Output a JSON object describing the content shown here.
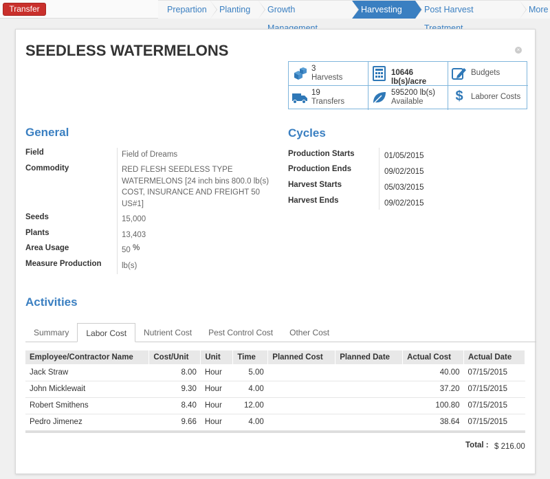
{
  "toolbar": {
    "transfer_label": "Transfer"
  },
  "breadcrumbs": [
    {
      "label": "Prepartion"
    },
    {
      "label": "Planting"
    },
    {
      "label": "Growth Management"
    },
    {
      "label": "Harvesting"
    },
    {
      "label": "Post Harvest Treatment"
    },
    {
      "label": "More"
    }
  ],
  "page": {
    "title": "SEEDLESS WATERMELONS",
    "close_glyph": "×"
  },
  "stats": {
    "harvests_count": "3",
    "harvests_label": "Harvests",
    "yield": "10646 lb(s)/acre",
    "budgets": "Budgets",
    "transfers_count": "19",
    "transfers_label": "Transfers",
    "available_qty": "595200 lb(s)",
    "available_label": "Available",
    "laborer_costs": "Laborer Costs",
    "dollar_glyph": "$"
  },
  "general": {
    "heading": "General",
    "field_label": "Field",
    "field_value": "Field of Dreams",
    "commodity_label": "Commodity",
    "commodity_value": "RED FLESH SEEDLESS TYPE WATERMELONS [24 inch bins 800.0 lb(s) COST, INSURANCE AND FREIGHT 50 US#1]",
    "seeds_label": "Seeds",
    "seeds_value": "15,000",
    "plants_label": "Plants",
    "plants_value": "13,403",
    "area_label": "Area Usage",
    "area_value": "50",
    "area_unit": "%",
    "measure_label": "Measure Production",
    "measure_value": "lb(s)"
  },
  "cycles": {
    "heading": "Cycles",
    "prod_start_label": "Production Starts",
    "prod_start_value": "01/05/2015",
    "prod_end_label": "Production Ends",
    "prod_end_value": "09/02/2015",
    "harv_start_label": "Harvest Starts",
    "harv_start_value": "05/03/2015",
    "harv_end_label": "Harvest Ends",
    "harv_end_value": "09/02/2015"
  },
  "activities": {
    "heading": "Activities",
    "tabs": [
      {
        "label": "Summary"
      },
      {
        "label": "Labor Cost"
      },
      {
        "label": "Nutrient Cost"
      },
      {
        "label": "Pest Control Cost"
      },
      {
        "label": "Other Cost"
      }
    ],
    "active_tab": "Labor Cost"
  },
  "labor_table": {
    "headers": [
      "Employee/Contractor Name",
      "Cost/Unit",
      "Unit",
      "Time",
      "Planned Cost",
      "Planned Date",
      "Actual Cost",
      "Actual Date"
    ],
    "rows": [
      {
        "name": "Jack Straw",
        "cost": "8.00",
        "unit": "Hour",
        "time": "5.00",
        "planned_cost": "",
        "planned_date": "",
        "actual_cost": "40.00",
        "actual_date": "07/15/2015"
      },
      {
        "name": "John Micklewait",
        "cost": "9.30",
        "unit": "Hour",
        "time": "4.00",
        "planned_cost": "",
        "planned_date": "",
        "actual_cost": "37.20",
        "actual_date": "07/15/2015"
      },
      {
        "name": "Robert Smithens",
        "cost": "8.40",
        "unit": "Hour",
        "time": "12.00",
        "planned_cost": "",
        "planned_date": "",
        "actual_cost": "100.80",
        "actual_date": "07/15/2015"
      },
      {
        "name": "Pedro Jimenez",
        "cost": "9.66",
        "unit": "Hour",
        "time": "4.00",
        "planned_cost": "",
        "planned_date": "",
        "actual_cost": "38.64",
        "actual_date": "07/15/2015"
      }
    ],
    "total_label": "Total :",
    "total_value": "$ 216.00"
  },
  "colors": {
    "accent": "#3a7fc1",
    "danger": "#c9302c"
  }
}
